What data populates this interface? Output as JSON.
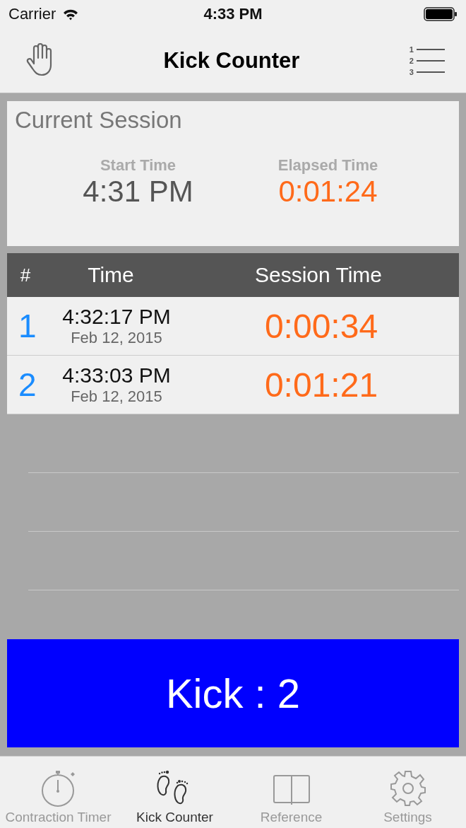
{
  "status_bar": {
    "carrier": "Carrier",
    "time": "4:33 PM"
  },
  "nav_bar": {
    "title": "Kick Counter",
    "list_numbers": [
      "1",
      "2",
      "3"
    ]
  },
  "current_session": {
    "title": "Current Session",
    "start_label": "Start Time",
    "start_value": "4:31 PM",
    "elapsed_label": "Elapsed Time",
    "elapsed_value": "0:01:24"
  },
  "table": {
    "columns": [
      "#",
      "Time",
      "Session Time"
    ],
    "rows": [
      {
        "number": "1",
        "time": "4:32:17 PM",
        "date": "Feb 12, 2015",
        "session_time": "0:00:34"
      },
      {
        "number": "2",
        "time": "4:33:03 PM",
        "date": "Feb 12, 2015",
        "session_time": "0:01:21"
      }
    ]
  },
  "kick_button": "Kick : 2",
  "tab_bar": [
    {
      "label": "Contraction Timer",
      "kind": "stopwatch",
      "selected": false
    },
    {
      "label": "Kick Counter",
      "kind": "feet",
      "selected": true
    },
    {
      "label": "Reference",
      "kind": "book",
      "selected": false
    },
    {
      "label": "Settings",
      "kind": "gear",
      "selected": false
    }
  ]
}
